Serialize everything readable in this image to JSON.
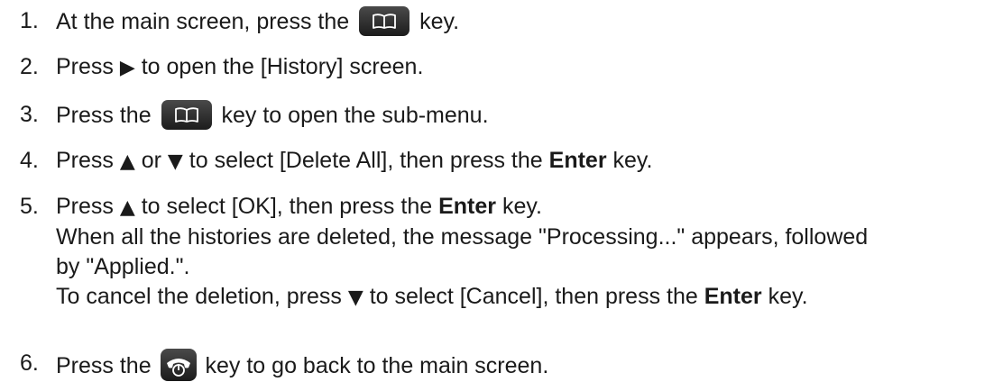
{
  "steps": [
    {
      "num": "1.",
      "before": "At the main screen, press the",
      "after": "key."
    },
    {
      "num": "2.",
      "before": "Press",
      "arrow": "▶",
      "after": "to open the [History] screen."
    },
    {
      "num": "3.",
      "before": "Press the",
      "after": "key to open the sub-menu."
    },
    {
      "num": "4.",
      "before": "Press",
      "arrow1": "▲",
      "mid": "or",
      "arrow2": "▼",
      "after": "to select [Delete All], then press the",
      "bold": "Enter",
      "end": "key."
    },
    {
      "num": "5.",
      "line1_before": "Press",
      "line1_arrow": "▲",
      "line1_after": "to select [OK], then press the",
      "line1_bold": "Enter",
      "line1_end": "key.",
      "line2": "When all the histories are deleted, the message \"Processing...\" appears, followed",
      "line3": "by \"Applied.\".",
      "line4_before": "To cancel the deletion, press",
      "line4_arrow": "▼",
      "line4_after": "to select [Cancel], then press the",
      "line4_bold": "Enter",
      "line4_end": "key."
    },
    {
      "num": "6.",
      "before": "Press the",
      "after": "key to go back to the main screen."
    }
  ],
  "icons": {
    "phonebook_key": "phonebook-key-icon",
    "end_call_key": "end-call-key-icon"
  }
}
